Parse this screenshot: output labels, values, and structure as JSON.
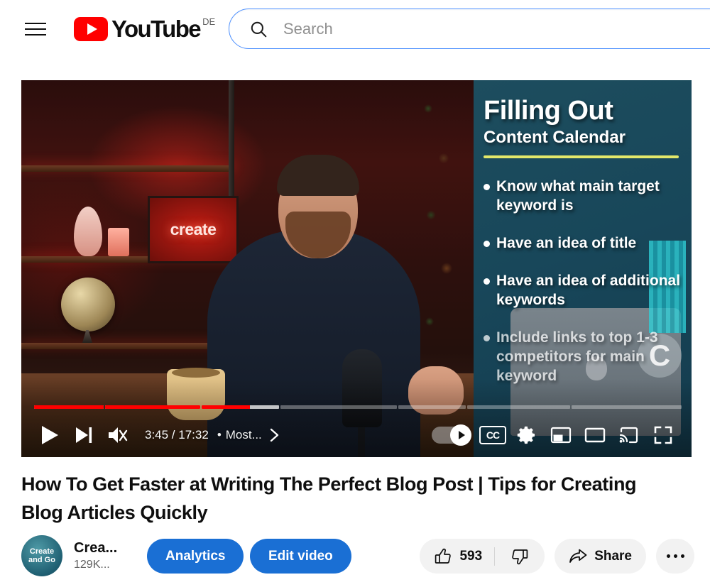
{
  "masthead": {
    "menu_icon": "hamburger-menu-icon",
    "logo_text": "YouTube",
    "country_code": "DE",
    "search": {
      "icon": "search-icon",
      "placeholder": "Search",
      "value": ""
    }
  },
  "player": {
    "state": "paused",
    "current_time": "3:45",
    "duration": "17:32",
    "time_display": "3:45 / 17:32",
    "separator": "•",
    "chapter_title": "Most...",
    "chapter_chevron": "chevron-right-icon",
    "controls": {
      "play": "play-icon",
      "next": "next-video-icon",
      "volume": "volume-muted-icon",
      "autoplay": "autoplay-toggle",
      "autoplay_on": true,
      "subtitles": "CC",
      "settings": "gear-icon",
      "miniplayer": "miniplayer-icon",
      "theater": "theater-mode-icon",
      "cast": "cast-icon",
      "fullscreen": "fullscreen-icon"
    },
    "progress": {
      "played_pct": 22.8,
      "loaded_pct": 30.5,
      "chapters": [
        {
          "width_pct": 10.8,
          "played_pct": 100,
          "loaded_pct": 100
        },
        {
          "width_pct": 14.8,
          "played_pct": 100,
          "loaded_pct": 100
        },
        {
          "width_pct": 12.0,
          "played_pct": 62,
          "loaded_pct": 100
        },
        {
          "width_pct": 18.0,
          "played_pct": 0,
          "loaded_pct": 0
        },
        {
          "width_pct": 10.5,
          "played_pct": 0,
          "loaded_pct": 0
        },
        {
          "width_pct": 16.0,
          "played_pct": 0,
          "loaded_pct": 0
        },
        {
          "width_pct": 17.0,
          "played_pct": 0,
          "loaded_pct": 0
        }
      ]
    },
    "slide": {
      "title": "Filling Out",
      "subtitle": "Content Calendar",
      "bullets": [
        "Know what main target keyword is",
        "Have an idea of title",
        "Have an idea of additional keywords",
        "Include links to top 1-3 competitors for main keyword"
      ],
      "badge_letter": "C",
      "accent_color": "#e3e86a",
      "background_color": "#18475a"
    },
    "scene": {
      "neon_sign_text": "create"
    }
  },
  "video": {
    "title": "How To Get Faster at Writing The Perfect Blog Post | Tips for Creating Blog Articles Quickly"
  },
  "owner": {
    "avatar_line1": "Create",
    "avatar_line2": "and Go",
    "channel_name": "Crea...",
    "subscribers": "129K...",
    "analytics_label": "Analytics",
    "edit_video_label": "Edit video"
  },
  "actions": {
    "like_icon": "thumbs-up-icon",
    "like_count": "593",
    "dislike_icon": "thumbs-down-icon",
    "share_icon": "share-arrow-icon",
    "share_label": "Share",
    "more_icon": "more-options-icon"
  },
  "colors": {
    "brand_red": "#ff0000",
    "button_blue": "#1a6fd4",
    "pill_grey": "#f2f2f2",
    "text_primary": "#0f0f0f",
    "text_secondary": "#606060"
  }
}
